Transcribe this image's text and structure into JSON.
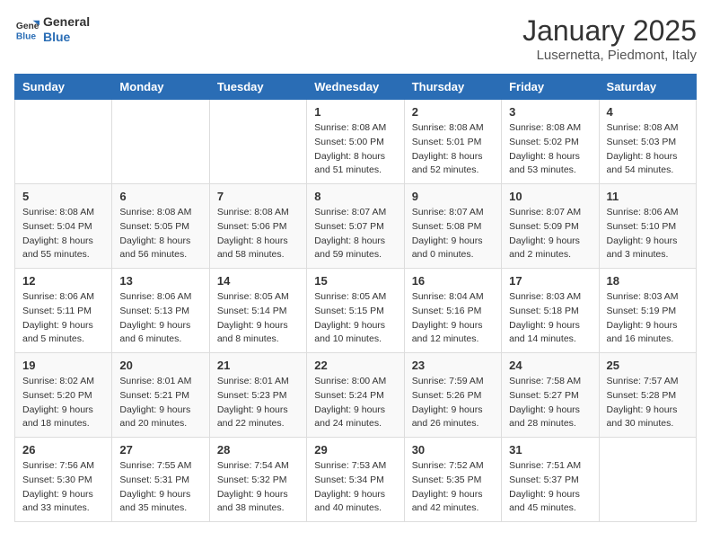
{
  "logo": {
    "general": "General",
    "blue": "Blue"
  },
  "header": {
    "month": "January 2025",
    "location": "Lusernetta, Piedmont, Italy"
  },
  "weekdays": [
    "Sunday",
    "Monday",
    "Tuesday",
    "Wednesday",
    "Thursday",
    "Friday",
    "Saturday"
  ],
  "weeks": [
    [
      {
        "day": "",
        "info": ""
      },
      {
        "day": "",
        "info": ""
      },
      {
        "day": "",
        "info": ""
      },
      {
        "day": "1",
        "info": "Sunrise: 8:08 AM\nSunset: 5:00 PM\nDaylight: 8 hours\nand 51 minutes."
      },
      {
        "day": "2",
        "info": "Sunrise: 8:08 AM\nSunset: 5:01 PM\nDaylight: 8 hours\nand 52 minutes."
      },
      {
        "day": "3",
        "info": "Sunrise: 8:08 AM\nSunset: 5:02 PM\nDaylight: 8 hours\nand 53 minutes."
      },
      {
        "day": "4",
        "info": "Sunrise: 8:08 AM\nSunset: 5:03 PM\nDaylight: 8 hours\nand 54 minutes."
      }
    ],
    [
      {
        "day": "5",
        "info": "Sunrise: 8:08 AM\nSunset: 5:04 PM\nDaylight: 8 hours\nand 55 minutes."
      },
      {
        "day": "6",
        "info": "Sunrise: 8:08 AM\nSunset: 5:05 PM\nDaylight: 8 hours\nand 56 minutes."
      },
      {
        "day": "7",
        "info": "Sunrise: 8:08 AM\nSunset: 5:06 PM\nDaylight: 8 hours\nand 58 minutes."
      },
      {
        "day": "8",
        "info": "Sunrise: 8:07 AM\nSunset: 5:07 PM\nDaylight: 8 hours\nand 59 minutes."
      },
      {
        "day": "9",
        "info": "Sunrise: 8:07 AM\nSunset: 5:08 PM\nDaylight: 9 hours\nand 0 minutes."
      },
      {
        "day": "10",
        "info": "Sunrise: 8:07 AM\nSunset: 5:09 PM\nDaylight: 9 hours\nand 2 minutes."
      },
      {
        "day": "11",
        "info": "Sunrise: 8:06 AM\nSunset: 5:10 PM\nDaylight: 9 hours\nand 3 minutes."
      }
    ],
    [
      {
        "day": "12",
        "info": "Sunrise: 8:06 AM\nSunset: 5:11 PM\nDaylight: 9 hours\nand 5 minutes."
      },
      {
        "day": "13",
        "info": "Sunrise: 8:06 AM\nSunset: 5:13 PM\nDaylight: 9 hours\nand 6 minutes."
      },
      {
        "day": "14",
        "info": "Sunrise: 8:05 AM\nSunset: 5:14 PM\nDaylight: 9 hours\nand 8 minutes."
      },
      {
        "day": "15",
        "info": "Sunrise: 8:05 AM\nSunset: 5:15 PM\nDaylight: 9 hours\nand 10 minutes."
      },
      {
        "day": "16",
        "info": "Sunrise: 8:04 AM\nSunset: 5:16 PM\nDaylight: 9 hours\nand 12 minutes."
      },
      {
        "day": "17",
        "info": "Sunrise: 8:03 AM\nSunset: 5:18 PM\nDaylight: 9 hours\nand 14 minutes."
      },
      {
        "day": "18",
        "info": "Sunrise: 8:03 AM\nSunset: 5:19 PM\nDaylight: 9 hours\nand 16 minutes."
      }
    ],
    [
      {
        "day": "19",
        "info": "Sunrise: 8:02 AM\nSunset: 5:20 PM\nDaylight: 9 hours\nand 18 minutes."
      },
      {
        "day": "20",
        "info": "Sunrise: 8:01 AM\nSunset: 5:21 PM\nDaylight: 9 hours\nand 20 minutes."
      },
      {
        "day": "21",
        "info": "Sunrise: 8:01 AM\nSunset: 5:23 PM\nDaylight: 9 hours\nand 22 minutes."
      },
      {
        "day": "22",
        "info": "Sunrise: 8:00 AM\nSunset: 5:24 PM\nDaylight: 9 hours\nand 24 minutes."
      },
      {
        "day": "23",
        "info": "Sunrise: 7:59 AM\nSunset: 5:26 PM\nDaylight: 9 hours\nand 26 minutes."
      },
      {
        "day": "24",
        "info": "Sunrise: 7:58 AM\nSunset: 5:27 PM\nDaylight: 9 hours\nand 28 minutes."
      },
      {
        "day": "25",
        "info": "Sunrise: 7:57 AM\nSunset: 5:28 PM\nDaylight: 9 hours\nand 30 minutes."
      }
    ],
    [
      {
        "day": "26",
        "info": "Sunrise: 7:56 AM\nSunset: 5:30 PM\nDaylight: 9 hours\nand 33 minutes."
      },
      {
        "day": "27",
        "info": "Sunrise: 7:55 AM\nSunset: 5:31 PM\nDaylight: 9 hours\nand 35 minutes."
      },
      {
        "day": "28",
        "info": "Sunrise: 7:54 AM\nSunset: 5:32 PM\nDaylight: 9 hours\nand 38 minutes."
      },
      {
        "day": "29",
        "info": "Sunrise: 7:53 AM\nSunset: 5:34 PM\nDaylight: 9 hours\nand 40 minutes."
      },
      {
        "day": "30",
        "info": "Sunrise: 7:52 AM\nSunset: 5:35 PM\nDaylight: 9 hours\nand 42 minutes."
      },
      {
        "day": "31",
        "info": "Sunrise: 7:51 AM\nSunset: 5:37 PM\nDaylight: 9 hours\nand 45 minutes."
      },
      {
        "day": "",
        "info": ""
      }
    ]
  ]
}
